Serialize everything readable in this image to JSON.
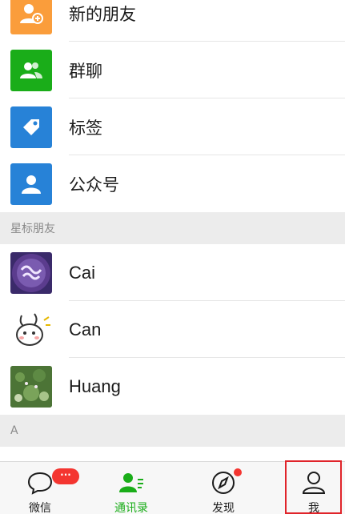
{
  "menu": [
    {
      "label": "新的朋友",
      "icon": "add-friend-icon",
      "color": "#fa9d3b"
    },
    {
      "label": "群聊",
      "icon": "group-chat-icon",
      "color": "#1aad19"
    },
    {
      "label": "标签",
      "icon": "tag-icon",
      "color": "#2782d7"
    },
    {
      "label": "公众号",
      "icon": "official-account-icon",
      "color": "#2782d7"
    }
  ],
  "starred_section": "星标朋友",
  "contacts": [
    {
      "name": "Cai"
    },
    {
      "name": "Can"
    },
    {
      "name": "Huang"
    }
  ],
  "section_a": "A",
  "badge": "···",
  "tabs": [
    {
      "label": "微信",
      "icon": "chat-bubble-icon"
    },
    {
      "label": "通讯录",
      "icon": "contacts-icon",
      "active": true
    },
    {
      "label": "发现",
      "icon": "compass-icon"
    },
    {
      "label": "我",
      "icon": "me-icon"
    }
  ],
  "colors": {
    "active": "#1aad19",
    "badge": "#f43530",
    "highlight": "#e0242a"
  }
}
